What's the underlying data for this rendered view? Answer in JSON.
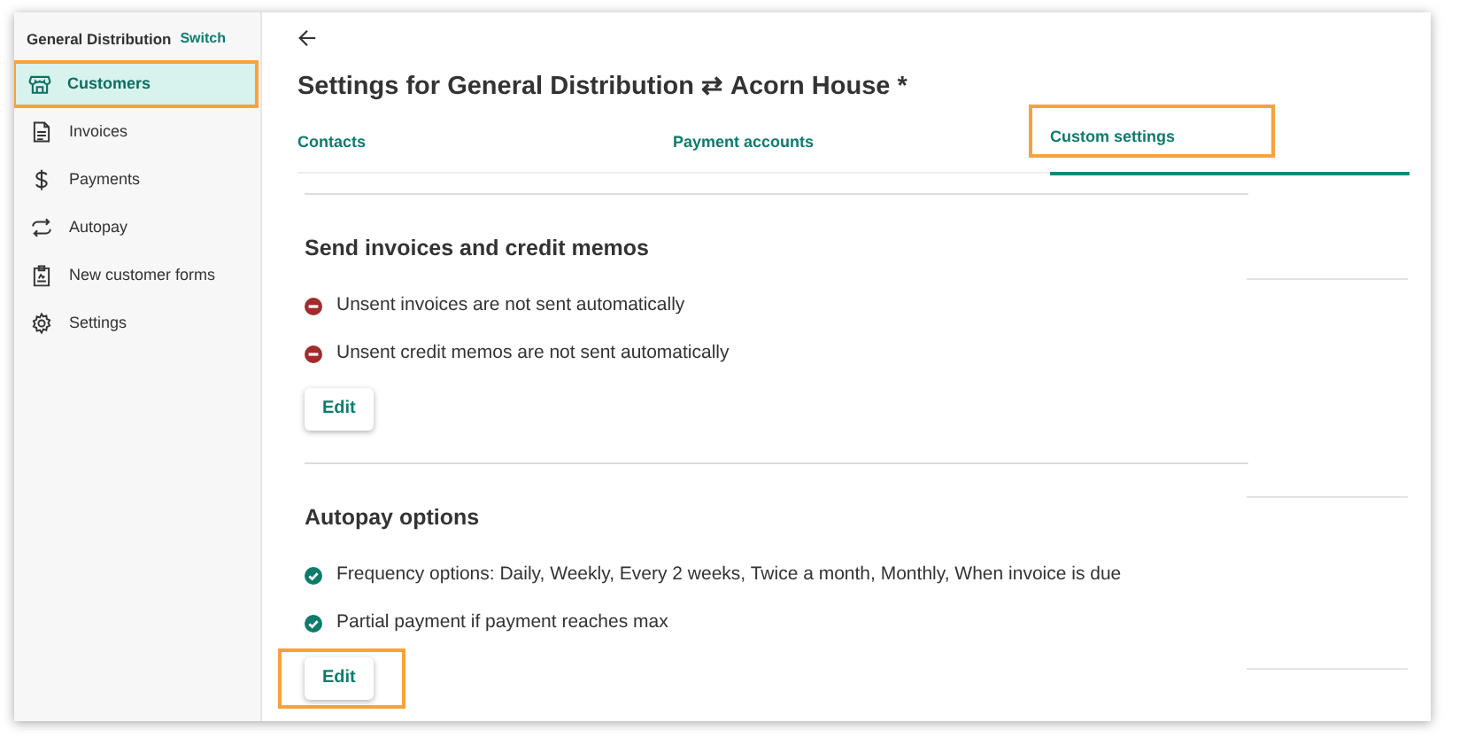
{
  "sidebar": {
    "org": "General Distribution",
    "switch_link": "Switch",
    "items": [
      {
        "label": "Customers",
        "selected": true,
        "highlighted": true
      },
      {
        "label": "Invoices",
        "selected": false,
        "highlighted": false
      },
      {
        "label": "Payments",
        "selected": false,
        "highlighted": false
      },
      {
        "label": "Autopay",
        "selected": false,
        "highlighted": false
      },
      {
        "label": "New customer forms",
        "selected": false,
        "highlighted": false
      },
      {
        "label": "Settings",
        "selected": false,
        "highlighted": false
      }
    ]
  },
  "page": {
    "title": "Settings for General Distribution ⇄ Acorn House *"
  },
  "tabs": [
    {
      "label": "Contacts",
      "selected": false,
      "highlighted": false
    },
    {
      "label": "Payment accounts",
      "selected": false,
      "highlighted": false
    },
    {
      "label": "Custom settings",
      "selected": true,
      "highlighted": true
    }
  ],
  "sections": [
    {
      "heading": "Send invoices and credit memos",
      "edit_label": "Edit",
      "edit_highlighted": false,
      "items": [
        {
          "text": "Unsent invoices are not sent automatically",
          "kind": "off"
        },
        {
          "text": "Unsent credit memos are not sent automatically",
          "kind": "off"
        }
      ]
    },
    {
      "heading": "Autopay options",
      "edit_label": "Edit",
      "edit_highlighted": true,
      "items": [
        {
          "text": "Frequency options: Daily, Weekly, Every 2 weeks, Twice a month, Monthly, When invoice is due",
          "kind": "on"
        },
        {
          "text": "Partial payment if payment reaches max",
          "kind": "on"
        }
      ]
    }
  ]
}
